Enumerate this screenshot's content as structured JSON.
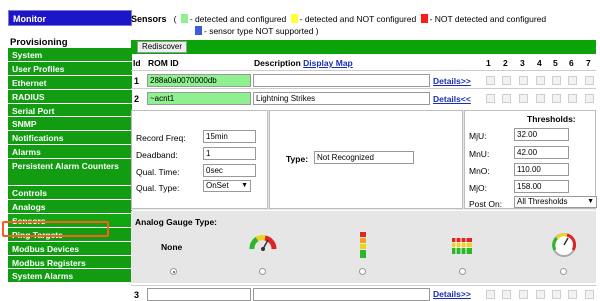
{
  "sidebar": {
    "monitor_label": "Monitor",
    "section_label": "Provisioning",
    "items": [
      {
        "label": "System"
      },
      {
        "label": "User Profiles"
      },
      {
        "label": "Ethernet"
      },
      {
        "label": "RADIUS"
      },
      {
        "label": "Serial Port"
      },
      {
        "label": "SNMP"
      },
      {
        "label": "Notifications"
      },
      {
        "label": "Alarms"
      },
      {
        "label": "Persistent Alarm Counters"
      },
      {
        "label": "Controls"
      },
      {
        "label": "Analogs"
      },
      {
        "label": "Sensors"
      },
      {
        "label": "Ping Targets"
      },
      {
        "label": "Modbus Devices"
      },
      {
        "label": "Modbus Registers"
      },
      {
        "label": "System Alarms"
      }
    ],
    "active_item": "Sensors"
  },
  "header": {
    "title": "Sensors",
    "legend_green": "- detected and configured",
    "legend_yellow": "- detected and NOT configured",
    "legend_red": "- NOT detected and configured",
    "legend_blue": "- sensor type NOT supported )",
    "open_paren": "(",
    "colors": {
      "green": "#8ef08e",
      "yellow": "#ffff33",
      "red": "#ff1a1a",
      "blue": "#3b5bd8"
    }
  },
  "toolbar": {
    "rediscover_label": "Rediscover"
  },
  "table": {
    "col_id": "Id",
    "col_rom": "ROM ID",
    "col_desc": "Description",
    "col_map_link": "Display Map",
    "point_cols": [
      "1",
      "2",
      "3",
      "4",
      "5",
      "6",
      "7"
    ],
    "rows": [
      {
        "id": "1",
        "rom": "288a0a0070000db",
        "desc": "",
        "details": "Details>>"
      },
      {
        "id": "2",
        "rom": "~acnt1",
        "desc": "Lightning Strikes",
        "details": "Details<<"
      },
      {
        "id": "3",
        "rom": "",
        "desc": "",
        "details": "Details>>"
      }
    ]
  },
  "detail": {
    "record_freq_label": "Record Freq:",
    "record_freq_value": "15min",
    "deadband_label": "Deadband:",
    "deadband_value": "1",
    "qual_time_label": "Qual. Time:",
    "qual_time_value": "0sec",
    "qual_type_label": "Qual. Type:",
    "qual_type_value": "OnSet",
    "type_label": "Type:",
    "type_value": "Not Recognized",
    "thresholds_label": "Thresholds:",
    "mju_label": "MjU:",
    "mju_value": "32.00",
    "mnu_label": "MnU:",
    "mnu_value": "42.00",
    "mno_label": "MnO:",
    "mno_value": "110.00",
    "mjo_label": "MjO:",
    "mjo_value": "158.00",
    "post_on_label": "Post On:",
    "post_on_value": "All Thresholds"
  },
  "gauge": {
    "label": "Analog Gauge Type:",
    "none_label": "None",
    "selected": "None"
  }
}
